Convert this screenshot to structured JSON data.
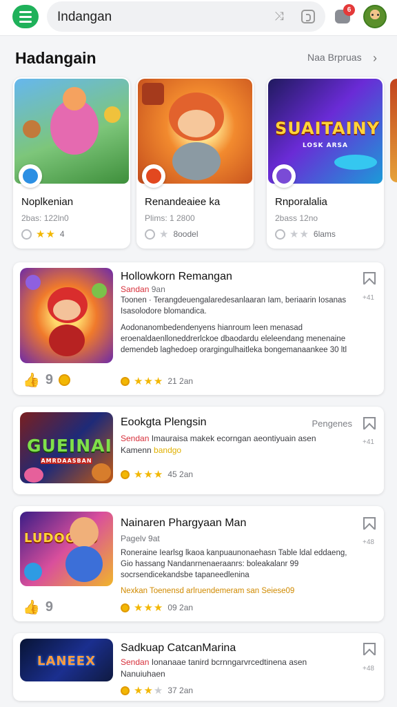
{
  "header": {
    "search_value": "Indangan",
    "notification_count": "6",
    "icons": [
      "menu-icon",
      "shuffle-icon",
      "voice-search-icon",
      "notification-icon",
      "avatar"
    ]
  },
  "featured": {
    "title": "Hadangain",
    "see_all_label": "Naa Brpruas",
    "cards": [
      {
        "name": "Noplkenian",
        "subtitle": "2bas: 122ln0",
        "rating": 2,
        "meta": "4"
      },
      {
        "name": "Renandeaiee ka",
        "subtitle": "Plims: 1 2800",
        "rating": 1,
        "meta": "8oodel"
      },
      {
        "name": "Rnporalalia",
        "subtitle": "2bass 12no",
        "rating": 2,
        "meta": "6lams"
      }
    ]
  },
  "list": [
    {
      "title": "Hollowkorn Remangan",
      "right_label": "",
      "category": "Sandan",
      "category_extra": "9an",
      "desc_1": "Toonen · Terangdeuengalaredesanlaaran Iam, beriaarin Iosanas Isasolodore blomandica.",
      "desc_2": "Aodonanombedendenyens hianroum leen menasad eroenaldaenlloneddrerlckoe dbaodardu eleleendang menenaine demendeb laghedoep orargingulhaitleka bongemanaankee 30 ltl",
      "rating_label": "21 2an",
      "rating": 3,
      "likes": "9",
      "bookmark_count": "+41"
    },
    {
      "title": "Eookgta Plengsin",
      "right_label": "Pengenes",
      "category": "Sendan",
      "category_extra": "Imauraisa makek ecorngan aeontiyuain asen",
      "desc_1": "Kamenn",
      "desc_2": "bandgo",
      "rating_label": "45 2an",
      "rating": 3,
      "likes": "",
      "bookmark_count": "+41"
    },
    {
      "title": "Nainaren Phargyaan Man",
      "right_label": "",
      "category": "Pagelv",
      "category_extra": "9at",
      "desc_1": "Roneraine Iearlsg lkaoa kanpuaunonaehasn Table ldal eddaeng, Gio hassang Nandanrnenaeraanrs: boleakalanr 99 socrsendicekandsbe tapaneedlenina",
      "desc_2": "Nexkan   Toenensd arlruendemeram san Seiese09",
      "rating_label": "09 2an",
      "rating": 3,
      "likes": "9",
      "bookmark_count": "+48"
    },
    {
      "title": "Sadkuap CatcanMarina",
      "right_label": "",
      "category": "Sendan",
      "category_extra": "Ionanaae tanird bcrnngarvrcedtinena asen",
      "desc_1": "Nanuiuhaen",
      "desc_2": "",
      "rating_label": "37 2an",
      "rating": 2,
      "likes": "",
      "bookmark_count": "+48"
    }
  ],
  "thumb_text": {
    "card3": "SUAITAINY",
    "card3_sub": "LOSK ARSA",
    "list2": "GUEINAI",
    "list2_sub": "AMRDAASBAN",
    "list3": "LUDOODO",
    "list4": "LANEEX"
  },
  "colors": {
    "accent_green": "#1fb15a",
    "star_yellow": "#f2b704",
    "category_red": "#d62f3a"
  }
}
